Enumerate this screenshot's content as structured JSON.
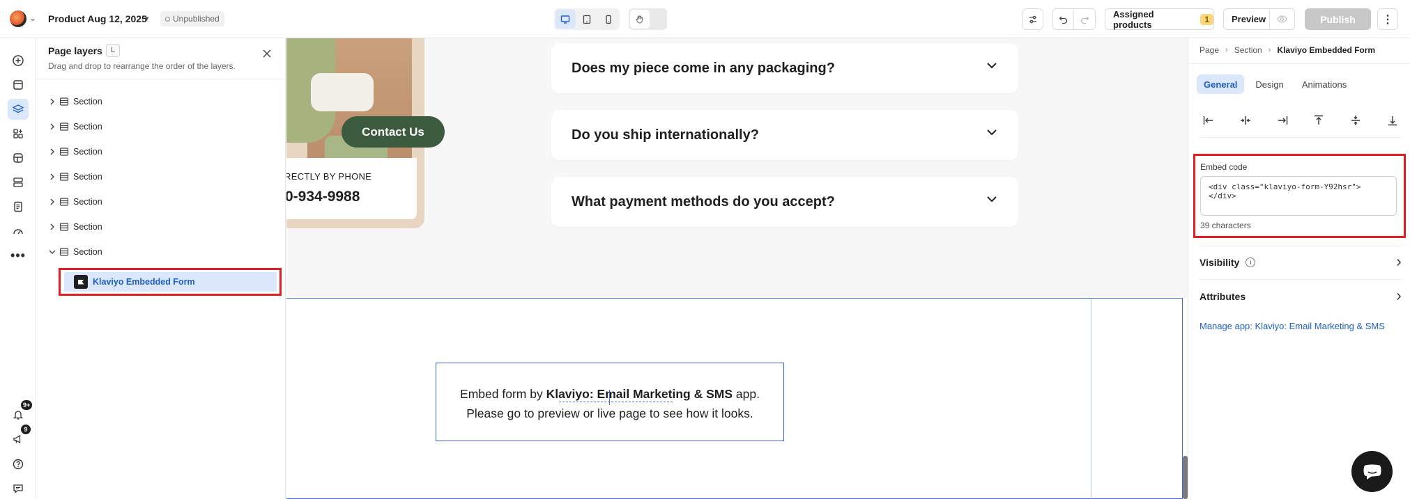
{
  "header": {
    "page_title": "Product Aug 12, 2025",
    "status": "Unpublished",
    "assigned_label": "Assigned products",
    "assigned_count": "1",
    "preview_label": "Preview",
    "publish_label": "Publish"
  },
  "rail": {
    "notification_count": "9+",
    "announcement_count": "9"
  },
  "layers": {
    "title": "Page layers",
    "shortcut": "L",
    "subtitle": "Drag and drop to rearrange the order of the layers.",
    "items": [
      {
        "label": "Section"
      },
      {
        "label": "Section"
      },
      {
        "label": "Section"
      },
      {
        "label": "Section"
      },
      {
        "label": "Section"
      },
      {
        "label": "Section"
      },
      {
        "label": "Section"
      }
    ],
    "child_label": "Klaviyo Embedded Form"
  },
  "canvas": {
    "contact_button": "Contact Us",
    "phone_label": "RECTLY BY PHONE",
    "phone_number": "0-934-9988",
    "faq": [
      {
        "question": "Does my piece come in any packaging?"
      },
      {
        "question": "Do you ship internationally?"
      },
      {
        "question": "What payment methods do you accept?"
      }
    ],
    "embed_text_1": "Embed form by ",
    "embed_app": "Klaviyo: Email Marketing & SMS",
    "embed_text_2": " app.",
    "embed_line_2": "Please go to preview or live page to see how it looks."
  },
  "right_panel": {
    "breadcrumb": [
      "Page",
      "Section",
      "Klaviyo Embedded Form"
    ],
    "tabs": [
      "General",
      "Design",
      "Animations"
    ],
    "embed_label": "Embed code",
    "embed_value": "<div class=\"klaviyo-form-Y92hsr\"></div>",
    "char_count": "39 characters",
    "visibility_label": "Visibility",
    "attributes_label": "Attributes",
    "manage_link": "Manage app: Klaviyo: Email Marketing & SMS"
  },
  "colors": {
    "accent": "#1f5fc7",
    "highlight": "#e21d24",
    "contact_button": "#3b5a3e"
  }
}
